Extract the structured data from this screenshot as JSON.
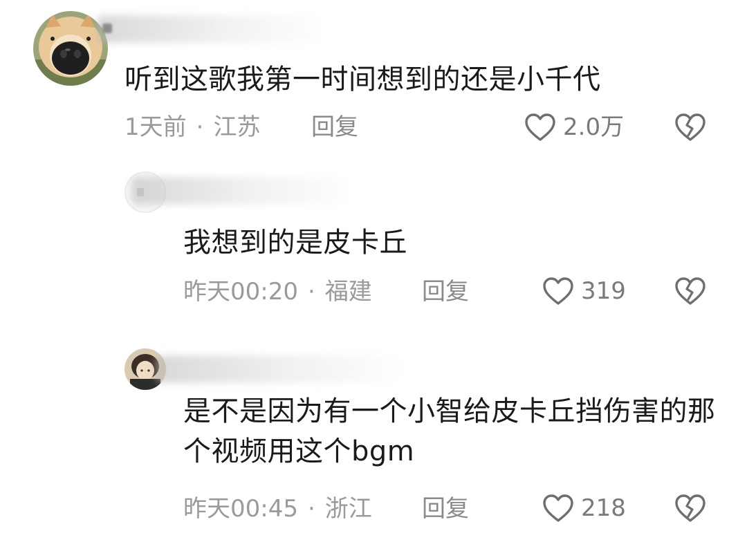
{
  "comments": [
    {
      "content": "听到这歌我第一时间想到的还是小千代",
      "time": "1天前",
      "separator": "·",
      "location": "江苏",
      "reply_label": "回复",
      "likes": "2.0万"
    },
    {
      "content": "我想到的是皮卡丘",
      "time": "昨天00:20",
      "separator": "·",
      "location": "福建",
      "reply_label": "回复",
      "likes": "319"
    },
    {
      "content": "是不是因为有一个小智给皮卡丘挡伤害的那个视频用这个bgm",
      "time": "昨天00:45",
      "separator": "·",
      "location": "浙江",
      "reply_label": "回复",
      "likes": "218"
    }
  ],
  "icons": {
    "like": "heart-outline-icon",
    "dislike": "broken-heart-icon"
  },
  "colors": {
    "text": "#1a1a1a",
    "meta": "#9a9a9a",
    "icon": "#6e6e6e"
  }
}
